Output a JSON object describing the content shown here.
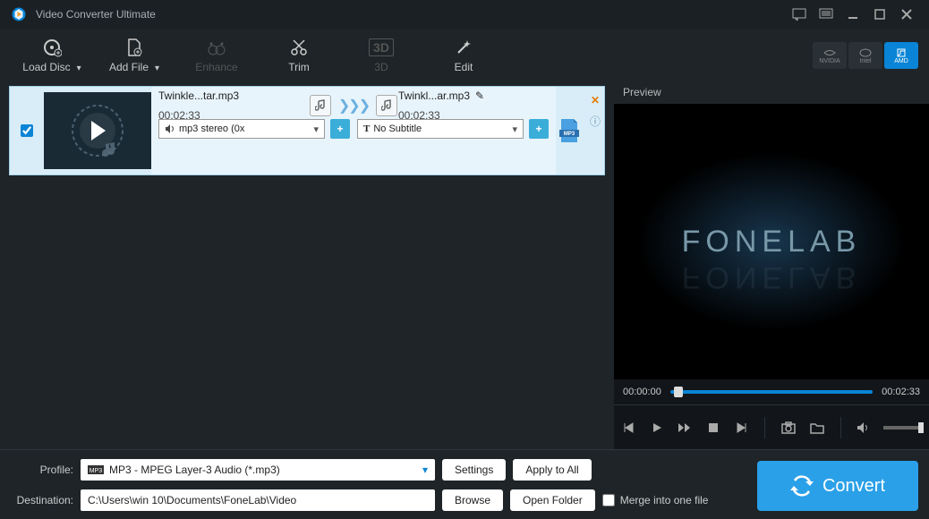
{
  "app": {
    "title": "Video Converter Ultimate"
  },
  "toolbar": {
    "load_disc": "Load Disc",
    "add_file": "Add File",
    "enhance": "Enhance",
    "trim": "Trim",
    "threeD": "3D",
    "edit": "Edit"
  },
  "gpu": {
    "nvidia": "NVIDIA",
    "intel": "Intel",
    "amd": "AMD"
  },
  "file": {
    "src_name": "Twinkle...tar.mp3",
    "src_time": "00:02:33",
    "dst_name": "Twinkl...ar.mp3",
    "dst_time": "00:02:33",
    "audio_sel": "mp3 stereo (0x",
    "subtitle_sel": "No Subtitle"
  },
  "preview": {
    "label": "Preview",
    "brand": "FONELAB",
    "time_start": "00:00:00",
    "time_end": "00:02:33"
  },
  "bottom": {
    "profile_label": "Profile:",
    "profile_value": "MP3 - MPEG Layer-3 Audio (*.mp3)",
    "dest_label": "Destination:",
    "dest_value": "C:\\Users\\win 10\\Documents\\FoneLab\\Video",
    "settings": "Settings",
    "apply_all": "Apply to All",
    "browse": "Browse",
    "open_folder": "Open Folder",
    "merge": "Merge into one file",
    "convert": "Convert"
  }
}
